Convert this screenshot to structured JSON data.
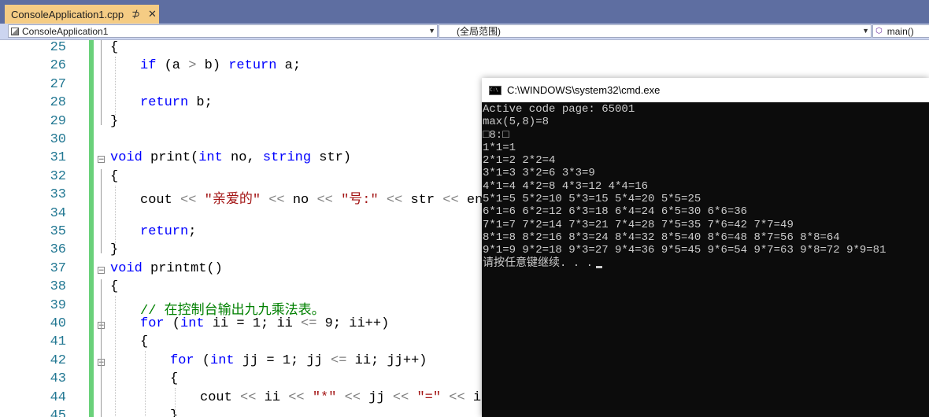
{
  "tab": {
    "filename": "ConsoleApplication1.cpp",
    "pin_glyph": "⊅",
    "close_glyph": "✕"
  },
  "navbar": {
    "project": "ConsoleApplication1",
    "scope": "(全局范围)",
    "member": "main()"
  },
  "editor": {
    "lines": [
      {
        "num": "25",
        "indent": 0,
        "tokens": [
          {
            "t": "{",
            "c": ""
          }
        ]
      },
      {
        "num": "26",
        "indent": 1,
        "tokens": [
          {
            "t": "if",
            "c": "kw"
          },
          {
            "t": " (a ",
            "c": ""
          },
          {
            "t": ">",
            "c": "op"
          },
          {
            "t": " b) ",
            "c": ""
          },
          {
            "t": "return",
            "c": "kw"
          },
          {
            "t": " a;",
            "c": ""
          }
        ]
      },
      {
        "num": "27",
        "indent": 0,
        "tokens": []
      },
      {
        "num": "28",
        "indent": 1,
        "tokens": [
          {
            "t": "return",
            "c": "kw"
          },
          {
            "t": " b;",
            "c": ""
          }
        ]
      },
      {
        "num": "29",
        "indent": 0,
        "tokens": [
          {
            "t": "}",
            "c": ""
          }
        ]
      },
      {
        "num": "30",
        "indent": 0,
        "tokens": []
      },
      {
        "num": "31",
        "indent": 0,
        "tokens": [
          {
            "t": "void",
            "c": "kw"
          },
          {
            "t": " print(",
            "c": ""
          },
          {
            "t": "int",
            "c": "kw"
          },
          {
            "t": " no, ",
            "c": ""
          },
          {
            "t": "string",
            "c": "kw"
          },
          {
            "t": " str)",
            "c": ""
          }
        ]
      },
      {
        "num": "32",
        "indent": 0,
        "tokens": [
          {
            "t": "{",
            "c": ""
          }
        ]
      },
      {
        "num": "33",
        "indent": 1,
        "tokens": [
          {
            "t": "cout ",
            "c": ""
          },
          {
            "t": "<<",
            "c": "op"
          },
          {
            "t": " ",
            "c": ""
          },
          {
            "t": "\"亲爱的\"",
            "c": "str"
          },
          {
            "t": " ",
            "c": ""
          },
          {
            "t": "<<",
            "c": "op"
          },
          {
            "t": " no ",
            "c": ""
          },
          {
            "t": "<<",
            "c": "op"
          },
          {
            "t": " ",
            "c": ""
          },
          {
            "t": "\"号:\"",
            "c": "str"
          },
          {
            "t": " ",
            "c": ""
          },
          {
            "t": "<<",
            "c": "op"
          },
          {
            "t": " str ",
            "c": ""
          },
          {
            "t": "<<",
            "c": "op"
          },
          {
            "t": " endl;",
            "c": ""
          }
        ]
      },
      {
        "num": "34",
        "indent": 0,
        "tokens": []
      },
      {
        "num": "35",
        "indent": 1,
        "tokens": [
          {
            "t": "return",
            "c": "kw"
          },
          {
            "t": ";",
            "c": ""
          }
        ]
      },
      {
        "num": "36",
        "indent": 0,
        "tokens": [
          {
            "t": "}",
            "c": ""
          }
        ]
      },
      {
        "num": "37",
        "indent": 0,
        "tokens": [
          {
            "t": "void",
            "c": "kw"
          },
          {
            "t": " printmt()",
            "c": ""
          }
        ]
      },
      {
        "num": "38",
        "indent": 0,
        "tokens": [
          {
            "t": "{",
            "c": ""
          }
        ]
      },
      {
        "num": "39",
        "indent": 1,
        "tokens": [
          {
            "t": "// 在控制台输出九九乘法表。",
            "c": "cmt"
          }
        ]
      },
      {
        "num": "40",
        "indent": 1,
        "tokens": [
          {
            "t": "for",
            "c": "kw"
          },
          {
            "t": " (",
            "c": ""
          },
          {
            "t": "int",
            "c": "kw"
          },
          {
            "t": " ii = 1; ii ",
            "c": ""
          },
          {
            "t": "<=",
            "c": "op"
          },
          {
            "t": " 9; ii++)",
            "c": ""
          }
        ]
      },
      {
        "num": "41",
        "indent": 1,
        "tokens": [
          {
            "t": "{",
            "c": ""
          }
        ]
      },
      {
        "num": "42",
        "indent": 2,
        "tokens": [
          {
            "t": "for",
            "c": "kw"
          },
          {
            "t": " (",
            "c": ""
          },
          {
            "t": "int",
            "c": "kw"
          },
          {
            "t": " jj = 1; jj ",
            "c": ""
          },
          {
            "t": "<=",
            "c": "op"
          },
          {
            "t": " ii; jj++)",
            "c": ""
          }
        ]
      },
      {
        "num": "43",
        "indent": 2,
        "tokens": [
          {
            "t": "{",
            "c": ""
          }
        ]
      },
      {
        "num": "44",
        "indent": 3,
        "tokens": [
          {
            "t": "cout ",
            "c": ""
          },
          {
            "t": "<<",
            "c": "op"
          },
          {
            "t": " ii ",
            "c": ""
          },
          {
            "t": "<<",
            "c": "op"
          },
          {
            "t": " ",
            "c": ""
          },
          {
            "t": "\"*\"",
            "c": "str"
          },
          {
            "t": " ",
            "c": ""
          },
          {
            "t": "<<",
            "c": "op"
          },
          {
            "t": " jj ",
            "c": ""
          },
          {
            "t": "<<",
            "c": "op"
          },
          {
            "t": " ",
            "c": ""
          },
          {
            "t": "\"=\"",
            "c": "str"
          },
          {
            "t": " ",
            "c": ""
          },
          {
            "t": "<<",
            "c": "op"
          },
          {
            "t": " ii *",
            "c": ""
          }
        ]
      },
      {
        "num": "45",
        "indent": 2,
        "tokens": [
          {
            "t": "}",
            "c": ""
          }
        ]
      }
    ]
  },
  "cmd": {
    "title": "C:\\WINDOWS\\system32\\cmd.exe",
    "icon_text": "C:\\",
    "lines": [
      "Active code page: 65001",
      "max(5,8)=8",
      "□8:□",
      "1*1=1",
      "2*1=2 2*2=4",
      "3*1=3 3*2=6 3*3=9",
      "4*1=4 4*2=8 4*3=12 4*4=16",
      "5*1=5 5*2=10 5*3=15 5*4=20 5*5=25",
      "6*1=6 6*2=12 6*3=18 6*4=24 6*5=30 6*6=36",
      "7*1=7 7*2=14 7*3=21 7*4=28 7*5=35 7*6=42 7*7=49",
      "8*1=8 8*2=16 8*3=24 8*4=32 8*5=40 8*6=48 8*7=56 8*8=64",
      "9*1=9 9*2=18 9*3=27 9*4=36 9*5=45 9*6=54 9*7=63 9*8=72 9*9=81",
      "请按任意键继续. . ."
    ]
  }
}
